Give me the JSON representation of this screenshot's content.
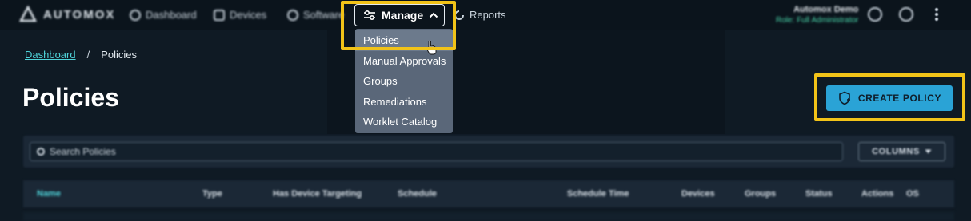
{
  "brand": {
    "name": "AUTOMOX"
  },
  "nav": {
    "items": [
      {
        "label": "Dashboard",
        "icon": "dashboard-icon"
      },
      {
        "label": "Devices",
        "icon": "devices-icon"
      },
      {
        "label": "Software",
        "icon": "software-icon"
      }
    ],
    "manage": {
      "label": "Manage",
      "icon": "sliders-icon",
      "expanded": true
    },
    "reports": {
      "label": "Reports",
      "icon": "reports-icon"
    }
  },
  "user": {
    "name": "Automox Demo",
    "role": "Role: Full Administrator"
  },
  "manage_menu": {
    "items": [
      {
        "label": "Policies",
        "hovered": true
      },
      {
        "label": "Manual Approvals"
      },
      {
        "label": "Groups"
      },
      {
        "label": "Remediations"
      },
      {
        "label": "Worklet Catalog"
      }
    ]
  },
  "breadcrumb": {
    "home": "Dashboard",
    "separator": "/",
    "current": "Policies"
  },
  "page": {
    "title": "Policies"
  },
  "create_button": {
    "label": "CREATE POLICY"
  },
  "search": {
    "placeholder": "Search Policies"
  },
  "columns_button": {
    "label": "COLUMNS"
  },
  "table": {
    "headers": [
      "Name",
      "Type",
      "Has Device Targeting",
      "Schedule",
      "Schedule Time",
      "Devices",
      "Groups",
      "Status",
      "Actions",
      "OS"
    ]
  },
  "colors": {
    "accent": "#2aa3d6",
    "highlight": "#f2c318",
    "link": "#4fd3d9",
    "background": "#0f1a24"
  }
}
